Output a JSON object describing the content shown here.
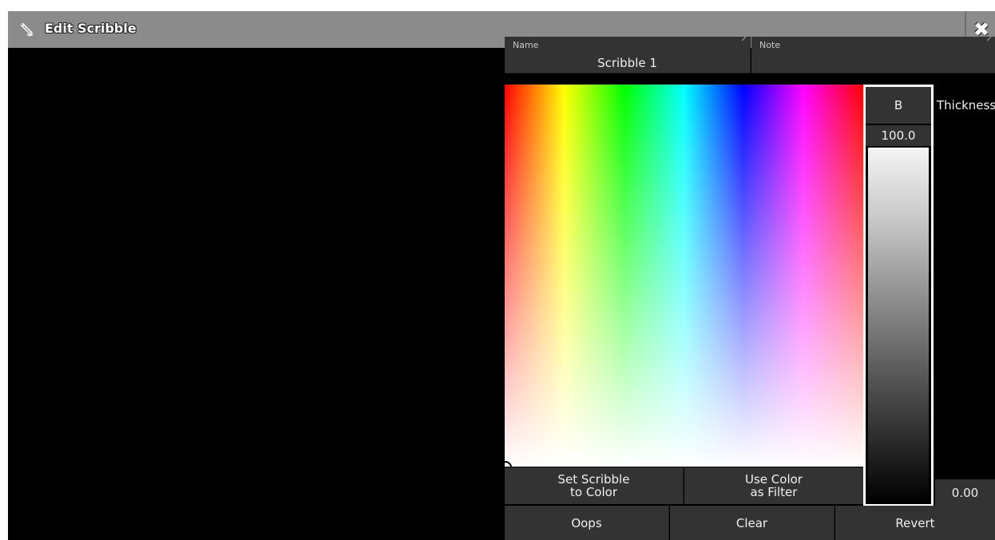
{
  "window": {
    "title": "Edit Scribble",
    "close_glyph": "✖"
  },
  "fields": {
    "name": {
      "label": "Name",
      "value": "Scribble 1"
    },
    "note": {
      "label": "Note",
      "value": ""
    }
  },
  "brightness": {
    "header": "B",
    "value": "100.0"
  },
  "thickness": {
    "header": "Thickness",
    "value": "0.00"
  },
  "buttons": {
    "set_scribble_line1": "Set Scribble",
    "set_scribble_line2": "to Color",
    "use_color_line1": "Use Color",
    "use_color_line2": "as Filter",
    "oops": "Oops",
    "clear": "Clear",
    "revert": "Revert"
  },
  "icons": {
    "title": "scribble-pen-icon",
    "close": "close-icon"
  },
  "colors": {
    "titlebar": "#8b8b8b",
    "panel": "#333333",
    "canvas": "#000000",
    "highlight": "#ffffff"
  }
}
